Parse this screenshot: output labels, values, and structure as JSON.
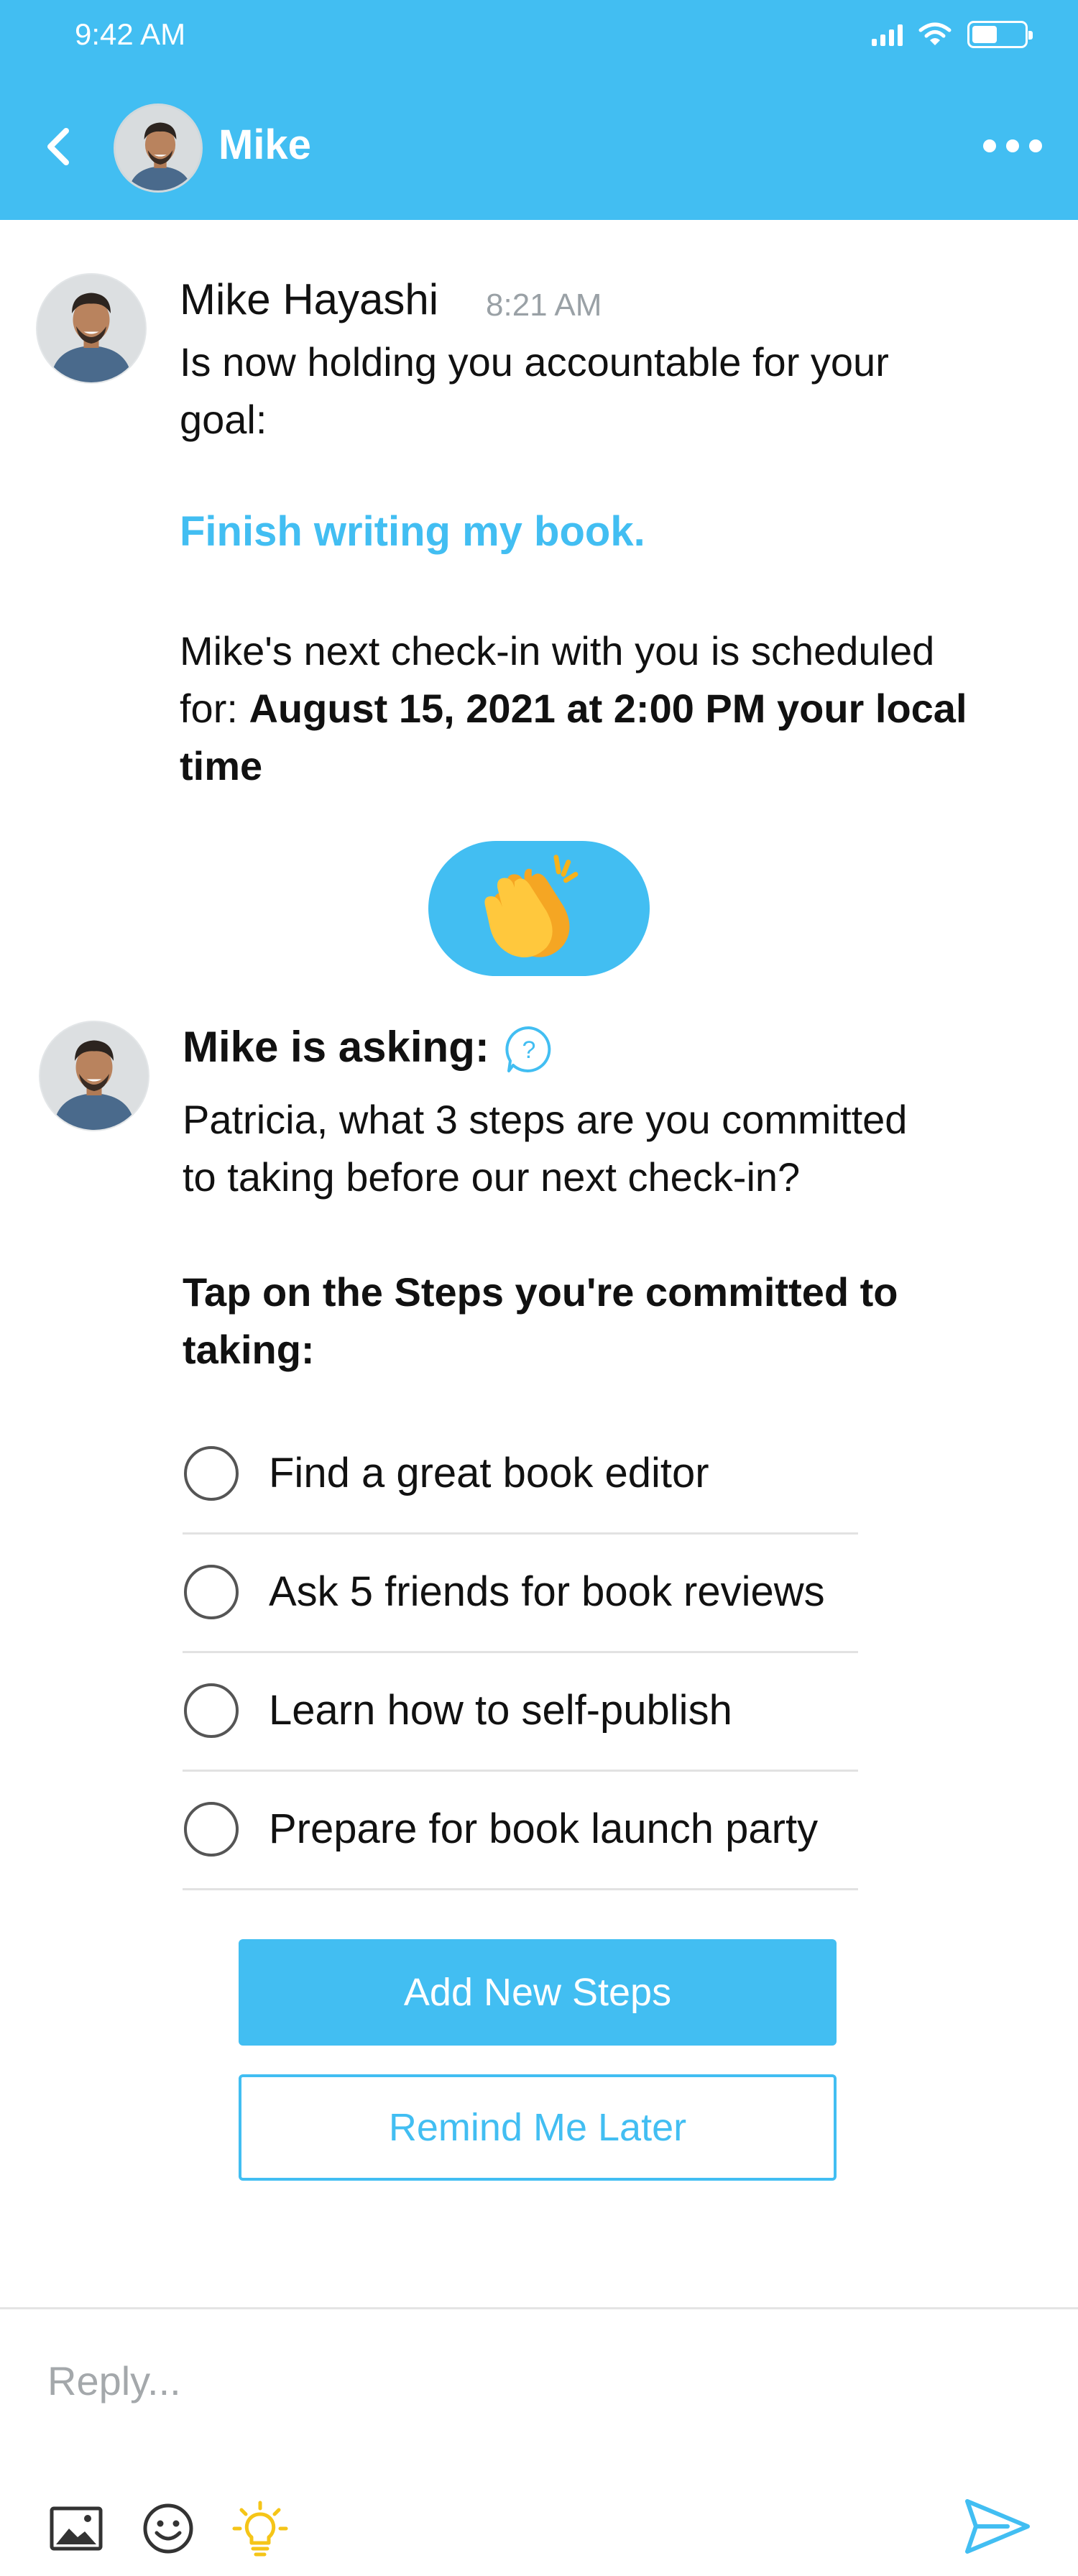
{
  "status_bar": {
    "time": "9:42 AM"
  },
  "header": {
    "name": "Mike",
    "back_icon": "chevron-left-icon",
    "more_icon": "more-horizontal-icon"
  },
  "message1": {
    "sender": "Mike Hayashi",
    "time": "8:21 AM",
    "line1": "Is now holding you accountable for your",
    "line2": "goal:",
    "goal": "Finish writing my book.",
    "checkin_line1": "Mike's next check-in with you is scheduled",
    "checkin_prefix": "for: ",
    "checkin_datetime": "August 15, 2021 at 2:00 PM your local",
    "checkin_suffix": "time",
    "reaction": "👏"
  },
  "message2": {
    "title": "Mike is asking:",
    "question_line1": "Patricia, what 3 steps are you committed",
    "question_line2": "to taking before our next check-in?",
    "instruction_line1": "Tap on the Steps you're committed to",
    "instruction_line2": "taking:",
    "steps": [
      "Find a great book editor",
      "Ask 5 friends for book reviews",
      "Learn how to self-publish",
      "Prepare for book launch party"
    ],
    "add_button": "Add New Steps",
    "remind_button": "Remind Me Later"
  },
  "composer": {
    "placeholder": "Reply..."
  },
  "colors": {
    "accent": "#42BEF2",
    "lightbulb": "#F5C518"
  }
}
